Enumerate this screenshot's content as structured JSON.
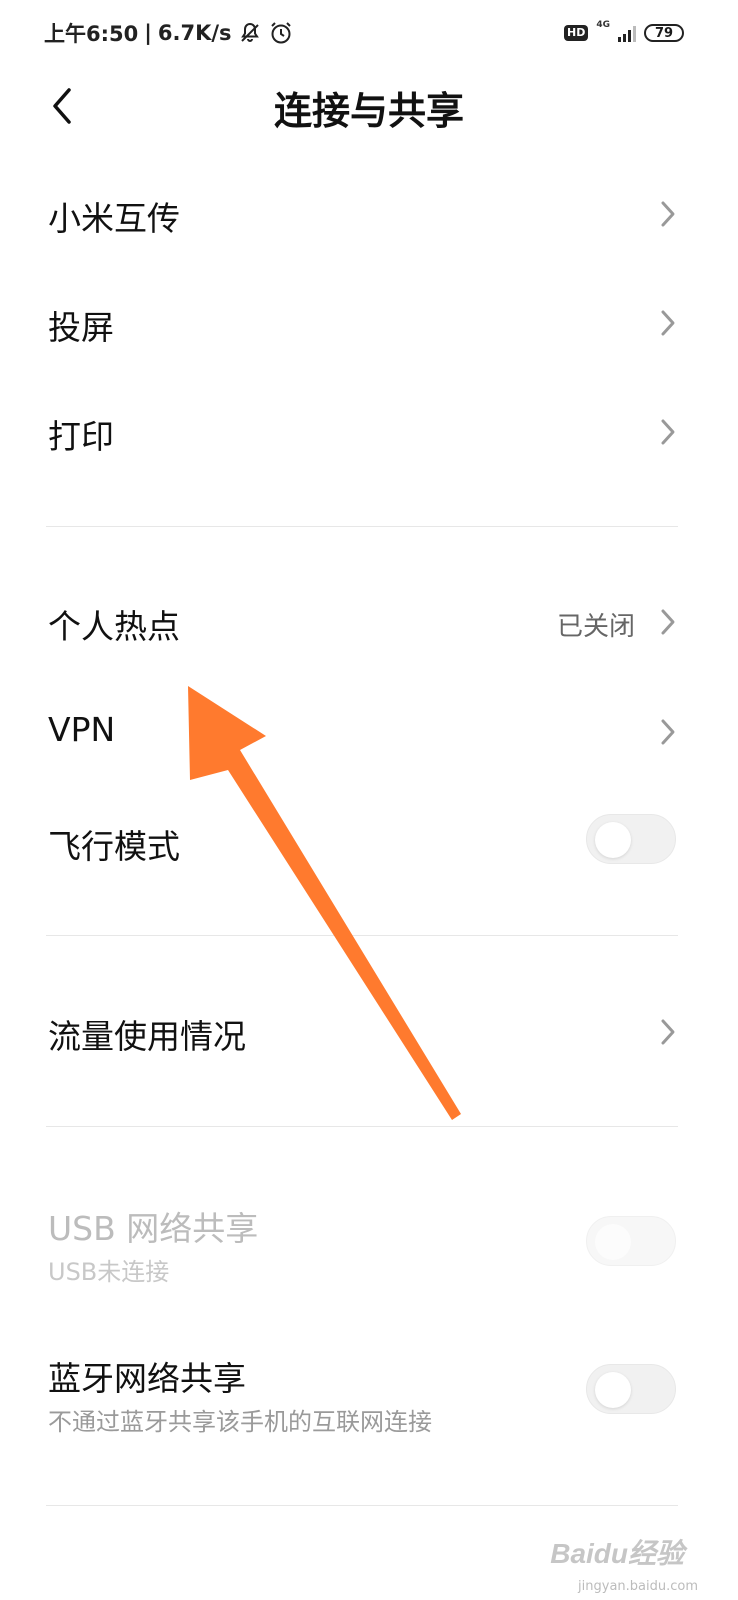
{
  "status_bar": {
    "time": "上午6:50",
    "separator": "|",
    "speed": "6.7K/s",
    "icons": [
      "mute-icon",
      "alarm-icon"
    ],
    "hd": "HD",
    "network": "4G",
    "battery": "79"
  },
  "header": {
    "title": "连接与共享",
    "back_icon": "chevron-left-icon"
  },
  "rows": {
    "mi_transfer": {
      "label": "小米互传"
    },
    "cast": {
      "label": "投屏"
    },
    "print": {
      "label": "打印"
    },
    "hotspot": {
      "label": "个人热点",
      "value": "已关闭"
    },
    "vpn": {
      "label": "VPN"
    },
    "airplane": {
      "label": "飞行模式",
      "enabled": false
    },
    "data_usage": {
      "label": "流量使用情况"
    },
    "usb_tether": {
      "label": "USB 网络共享",
      "sub": "USB未连接",
      "enabled": false,
      "disabled": true
    },
    "bt_tether": {
      "label": "蓝牙网络共享",
      "sub": "不通过蓝牙共享该手机的互联网连接",
      "enabled": false
    }
  },
  "annotation": {
    "color": "#ff7a2e"
  },
  "watermark": {
    "text": "Baidu经验",
    "sub": "jingyan.baidu.com"
  }
}
